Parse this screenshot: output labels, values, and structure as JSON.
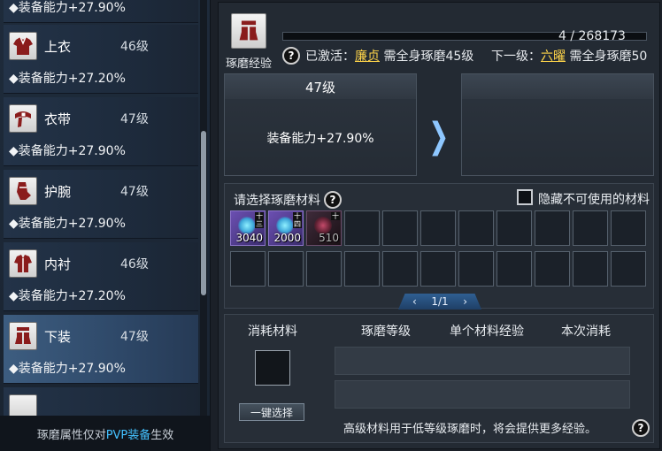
{
  "equipment_list": {
    "items": [
      {
        "name": "",
        "level": "",
        "stat": "◆装备能力+27.90%"
      },
      {
        "name": "上衣",
        "level": "46级",
        "stat": "◆装备能力+27.20%"
      },
      {
        "name": "衣带",
        "level": "47级",
        "stat": "◆装备能力+27.90%"
      },
      {
        "name": "护腕",
        "level": "47级",
        "stat": "◆装备能力+27.90%"
      },
      {
        "name": "内衬",
        "level": "46级",
        "stat": "◆装备能力+27.20%"
      },
      {
        "name": "下装",
        "level": "47级",
        "stat": "◆装备能力+27.90%"
      }
    ],
    "selected_index": 5,
    "footer_prefix": "琢磨属性仅对",
    "footer_highlight": "PVP装备",
    "footer_suffix": "生效"
  },
  "header": {
    "icon": "pants-icon",
    "label": "琢磨经验",
    "exp_text": "4 / 268173",
    "exp_fraction": 1e-05,
    "active_prefix": "已激活：",
    "active_name": "廉贞",
    "active_suffix": " 需全身琢磨45级",
    "next_prefix": "下一级：",
    "next_name": "六曜",
    "next_suffix": " 需全身琢磨50"
  },
  "current": {
    "level": "47级",
    "stat": "装备能力+27.90%"
  },
  "next": {
    "level": "",
    "stat": ""
  },
  "materials": {
    "title": "请选择琢磨材料",
    "hide_label": "隐藏不可使用的材料",
    "hide_checked": false,
    "items": [
      {
        "count": "3040",
        "rank": "十三",
        "usable": true
      },
      {
        "count": "2000",
        "rank": "十四",
        "usable": true
      },
      {
        "count": "510",
        "rank": "十",
        "usable": false
      }
    ],
    "page": "1/1",
    "prev": "‹",
    "next": "›"
  },
  "consume": {
    "col_material": "消耗材料",
    "col_level": "琢磨等级",
    "col_exp": "单个材料经验",
    "col_cost": "本次消耗",
    "one_click_label": "一键选择",
    "hint": "高级材料用于低等级琢磨时，将会提供更多经验。"
  },
  "colors": {
    "accent_blue": "#44c1ff",
    "gold": "#ffd54a"
  }
}
